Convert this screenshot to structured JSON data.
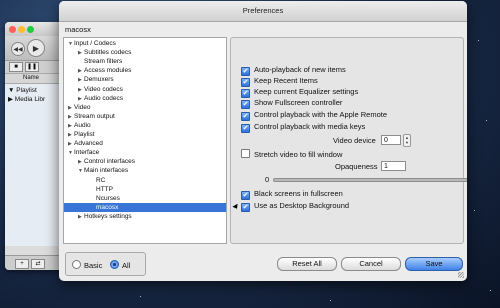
{
  "vlc": {
    "sidebar_items": [
      "▼ Playlist",
      "▶ Media Libr"
    ],
    "name_header": "Name"
  },
  "prefs": {
    "title": "Preferences",
    "section": "macosx",
    "tree": [
      {
        "label": "Input / Codecs",
        "level": 0,
        "expander": "▼"
      },
      {
        "label": "Subtitles codecs",
        "level": 1,
        "expander": "▶"
      },
      {
        "label": "Stream filters",
        "level": 1,
        "expander": ""
      },
      {
        "label": "Access modules",
        "level": 1,
        "expander": "▶"
      },
      {
        "label": "Demuxers",
        "level": 1,
        "expander": "▶"
      },
      {
        "label": "Video codecs",
        "level": 1,
        "expander": "▶"
      },
      {
        "label": "Audio codecs",
        "level": 1,
        "expander": "▶"
      },
      {
        "label": "Video",
        "level": 0,
        "expander": "▶"
      },
      {
        "label": "Stream output",
        "level": 0,
        "expander": "▶"
      },
      {
        "label": "Audio",
        "level": 0,
        "expander": "▶"
      },
      {
        "label": "Playlist",
        "level": 0,
        "expander": "▶"
      },
      {
        "label": "Advanced",
        "level": 0,
        "expander": "▶"
      },
      {
        "label": "Interface",
        "level": 0,
        "expander": "▼"
      },
      {
        "label": "Control interfaces",
        "level": 1,
        "expander": "▶"
      },
      {
        "label": "Main interfaces",
        "level": 1,
        "expander": "▼"
      },
      {
        "label": "RC",
        "level": 2,
        "expander": ""
      },
      {
        "label": "HTTP",
        "level": 2,
        "expander": ""
      },
      {
        "label": "Ncurses",
        "level": 2,
        "expander": ""
      },
      {
        "label": "macosx",
        "level": 2,
        "expander": "",
        "selected": true
      },
      {
        "label": "Hotkeys settings",
        "level": 1,
        "expander": "▶"
      }
    ],
    "options": [
      {
        "label": "Auto-playback of new items",
        "checked": true
      },
      {
        "label": "Keep Recent Items",
        "checked": true
      },
      {
        "label": "Keep current Equalizer settings",
        "checked": true
      },
      {
        "label": "Show Fullscreen controller",
        "checked": true
      },
      {
        "label": "Control playback with the Apple Remote",
        "checked": true
      },
      {
        "label": "Control playback with media keys",
        "checked": true
      }
    ],
    "video_device_label": "Video device",
    "video_device_value": "0",
    "stretch_label": "Stretch video to fill window",
    "stretch_checked": false,
    "opaqueness_label": "Opaqueness",
    "opaqueness_value": "1",
    "slider_min": "0",
    "slider_max": "1",
    "slider_level": 1,
    "black_screens_label": "Black screens in fullscreen",
    "black_screens_checked": true,
    "desktop_bg_label": "Use as Desktop Background",
    "desktop_bg_checked": true,
    "radio_basic": "Basic",
    "radio_all": "All",
    "radio_selected": "All",
    "reset_label": "Reset All",
    "cancel_label": "Cancel",
    "save_label": "Save",
    "check_glyph": "✔"
  }
}
